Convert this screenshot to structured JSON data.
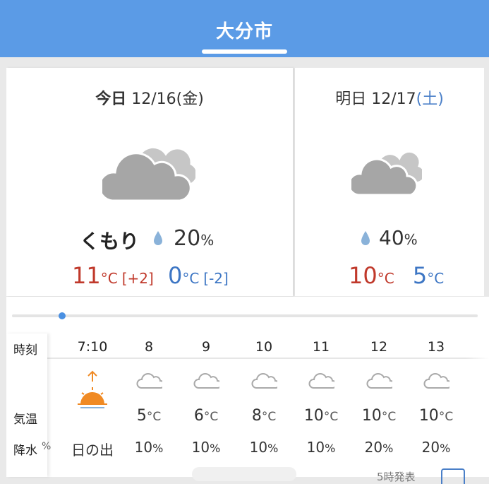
{
  "header": {
    "city": "大分市"
  },
  "today": {
    "day_label": "今日",
    "date": "12/16",
    "weekday": "(金)",
    "condition": "くもり",
    "pop_value": "20",
    "pop_unit": "%",
    "high": "11",
    "high_diff": "[+2]",
    "low": "0",
    "low_diff": "[-2]",
    "temp_unit": "°C",
    "icon": "cloudy-icon"
  },
  "tomorrow": {
    "day_label": "明日",
    "date": "12/17",
    "weekday": "(土)",
    "pop_value": "40",
    "pop_unit": "%",
    "high": "10",
    "low": "5",
    "temp_unit": "°C",
    "icon": "cloudy-icon"
  },
  "hourly": {
    "labels": {
      "time": "時刻",
      "temp": "気温",
      "rain": "降水"
    },
    "cut_left_rain": "%",
    "sunrise_text": "日の出",
    "hours": [
      {
        "time": "7:10",
        "temp": "",
        "rain": "日の出",
        "icon": "sunrise-icon"
      },
      {
        "time": "8",
        "temp": "5",
        "rain": "10",
        "icon": "cloud-icon"
      },
      {
        "time": "9",
        "temp": "6",
        "rain": "10",
        "icon": "cloud-icon"
      },
      {
        "time": "10",
        "temp": "8",
        "rain": "10",
        "icon": "cloud-icon"
      },
      {
        "time": "11",
        "temp": "10",
        "rain": "10",
        "icon": "cloud-icon"
      },
      {
        "time": "12",
        "temp": "10",
        "rain": "20",
        "icon": "cloud-icon"
      },
      {
        "time": "13",
        "temp": "10",
        "rain": "20",
        "icon": "cloud-icon"
      }
    ],
    "temp_unit": "°C",
    "rain_unit": "%"
  },
  "footer": {
    "partial_text": "5時発表"
  },
  "colors": {
    "header": "#5b9be6",
    "high": "#c0392b",
    "low": "#3d76c4",
    "sunrise": "#f08a24"
  }
}
